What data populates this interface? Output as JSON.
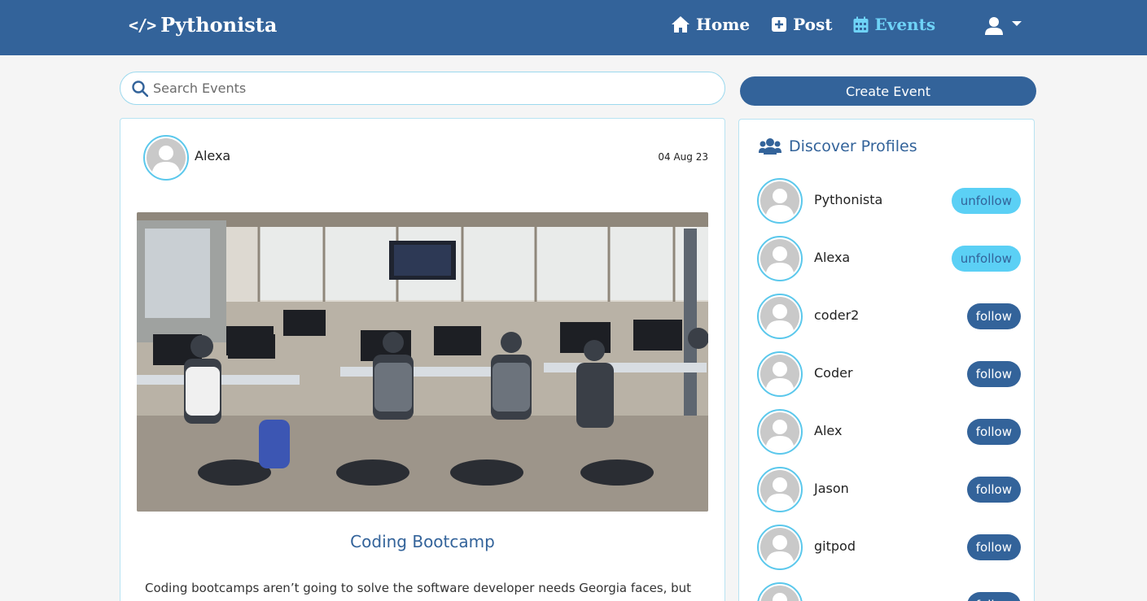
{
  "navbar": {
    "brand": "Pythonista",
    "links": [
      {
        "label": "Home",
        "icon": "home-icon",
        "active": false
      },
      {
        "label": "Post",
        "icon": "plus-square-icon",
        "active": false
      },
      {
        "label": "Events",
        "icon": "calendar-icon",
        "active": true
      }
    ],
    "user_icon": "user-icon"
  },
  "colors": {
    "primary": "#33639a",
    "accent": "#5bd0f5",
    "border": "#b8e3f2"
  },
  "search": {
    "placeholder": "Search Events",
    "value": ""
  },
  "create_event_label": "Create Event",
  "event": {
    "author": "Alexa",
    "date": "04 Aug 23",
    "image_description": "",
    "title": "Coding Bootcamp",
    "description": "Coding bootcamps aren’t going to solve the software developer needs Georgia faces, but"
  },
  "profiles": {
    "title": "Discover Profiles",
    "items": [
      {
        "name": "Pythonista",
        "action": "unfollow"
      },
      {
        "name": "Alexa",
        "action": "unfollow"
      },
      {
        "name": "coder2",
        "action": "follow"
      },
      {
        "name": "Coder",
        "action": "follow"
      },
      {
        "name": "Alex",
        "action": "follow"
      },
      {
        "name": "Jason",
        "action": "follow"
      },
      {
        "name": "gitpod",
        "action": "follow"
      },
      {
        "name": "",
        "action": "follow"
      }
    ]
  }
}
